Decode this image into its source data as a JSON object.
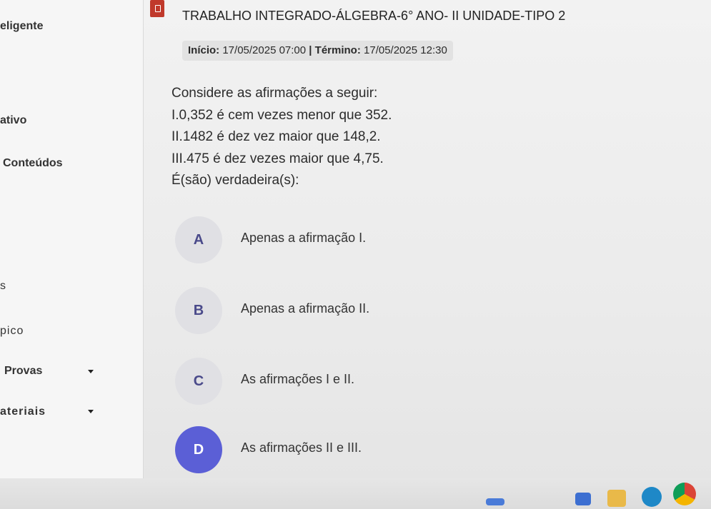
{
  "sidebar": {
    "items": [
      {
        "label": "eligente",
        "has_caret": false
      },
      {
        "label": "ativo",
        "has_caret": false
      },
      {
        "label": "Conteúdos",
        "has_caret": false
      },
      {
        "label": "s",
        "has_caret": false
      },
      {
        "label": "pico",
        "has_caret": false
      },
      {
        "label": "Provas",
        "has_caret": true
      },
      {
        "label": "ateriais",
        "has_caret": true
      }
    ]
  },
  "header": {
    "title": "TRABALHO INTEGRADO-ÁLGEBRA-6° ANO- II UNIDADE-TIPO 2",
    "start_label": "Início:",
    "start_value": "17/05/2025 07:00",
    "separator": "|",
    "end_label": "Término:",
    "end_value": "17/05/2025 12:30"
  },
  "question": {
    "lines": [
      "Considere as afirmações a seguir:",
      "I.0,352 é cem vezes menor que 352.",
      "II.1482 é dez vez maior que 148,2.",
      "III.475 é dez vezes maior que 4,75.",
      "É(são) verdadeira(s):"
    ]
  },
  "options": [
    {
      "letter": "A",
      "text": "Apenas a afirmação I.",
      "selected": false
    },
    {
      "letter": "B",
      "text": "Apenas a afirmação II.",
      "selected": false
    },
    {
      "letter": "C",
      "text": "As afirmações I e II.",
      "selected": false
    },
    {
      "letter": "D",
      "text": "As afirmações II e III.",
      "selected": true
    }
  ],
  "colors": {
    "selected_option": "#5b5fd6",
    "option_circle": "#e0e0e4",
    "badge": "#c0392b"
  },
  "taskbar": {
    "icons": [
      "app-icon",
      "app-icon",
      "folder-icon",
      "edge-icon",
      "chrome-icon"
    ]
  }
}
